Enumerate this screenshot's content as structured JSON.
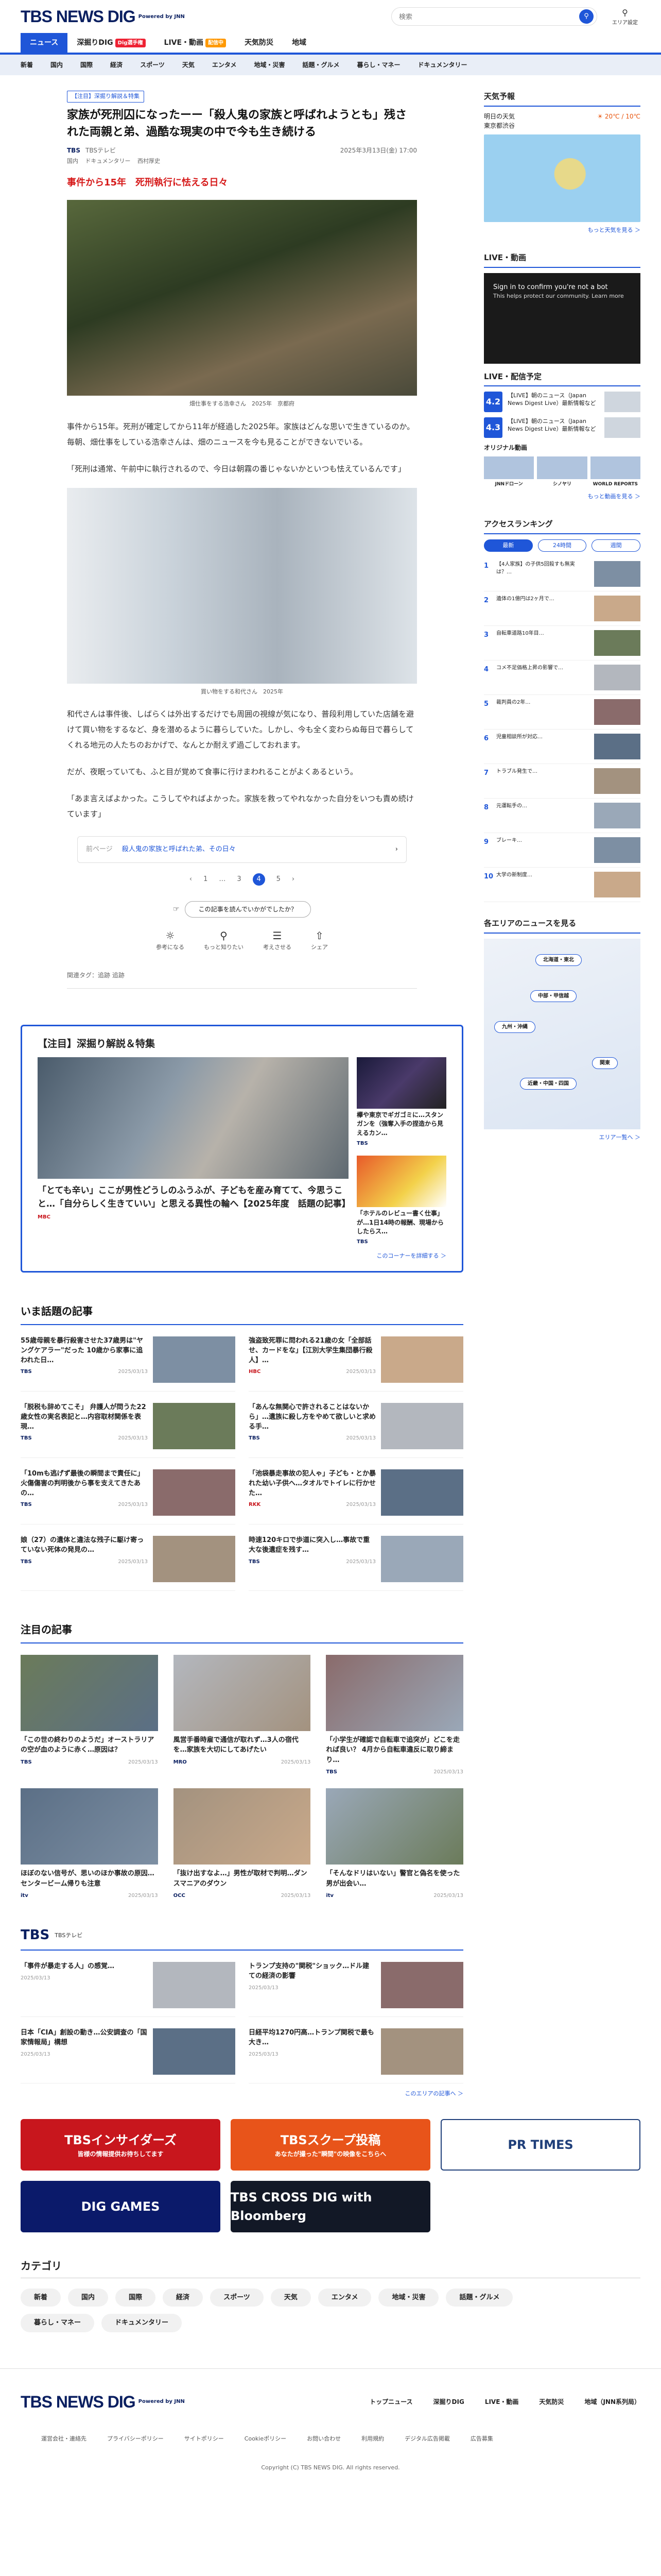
{
  "header": {
    "logo": "TBS NEWS DIG",
    "powered": "Powered by JNN",
    "search_placeholder": "検索",
    "area_label": "エリア設定"
  },
  "nav": [
    {
      "label": "ニュース",
      "badge": ""
    },
    {
      "label": "深掘りDIG",
      "badge": "Dig選手権"
    },
    {
      "label": "LIVE・動画",
      "badge": "配信中"
    },
    {
      "label": "天気防災",
      "badge": ""
    },
    {
      "label": "地域",
      "badge": ""
    }
  ],
  "subnav": [
    "新着",
    "国内",
    "国際",
    "経済",
    "スポーツ",
    "天気",
    "エンタメ",
    "地域・災害",
    "話題・グルメ",
    "暮らし・マネー",
    "ドキュメンタリー"
  ],
  "article": {
    "tag": "【注目】深掘り解説＆特集",
    "title": "家族が死刑囚になったーー「殺人鬼の家族と呼ばれようとも」残された両親と弟、過酷な現実の中で今も生き続ける",
    "source": "TBS",
    "source2": "TBSテレビ",
    "date": "2025年3月13日(金) 17:00",
    "crumbs": [
      "国内",
      "ドキュメンタリー",
      "西村厚史"
    ],
    "subhead": "事件から15年　死刑執行に怯える日々",
    "caption1": "畑仕事をする浩幸さん　2025年　京都府",
    "p1": "事件から15年。死刑が確定してから11年が経過した2025年。家族はどんな思いで生きているのか。毎朝、畑仕事をしている浩幸さんは、畑のニュースを今も見ることができないでいる。",
    "p2": "「死刑は通常、午前中に執行されるので、今日は朝霧の番じゃないかといつも怯えているんです」",
    "caption2": "買い物をする和代さん　2025年",
    "p3": "和代さんは事件後、しばらくは外出するだけでも周囲の視線が気になり、普段利用していた店舗を避けて買い物をするなど、身を潜めるように暮らしていた。しかし、今も全く変わらぬ毎日で暮らしてくれる地元の人たちのおかげで、なんとか耐えず過ごしておれます。",
    "p4": "だが、夜眠っていても、ふと目が覚めて食事に行けまわれることがよくあるという。",
    "p5": "「あま言えばよかった。こうしてやればよかった。家族を救ってやれなかった自分をいつも責め続けています」",
    "prev_label": "前ページ",
    "prev_title": "殺人鬼の家族と呼ばれた弟、その日々",
    "pages": [
      "1",
      "…",
      "3",
      "4",
      "5"
    ],
    "current_page": "4",
    "helpful_q": "この記事を読んでいかがでしたか？",
    "reactions": [
      "参考になる",
      "もっと知りたい",
      "考えさせる",
      "シェア"
    ],
    "credit": "関連タグ：追跡 追跡"
  },
  "feature": {
    "title": "【注目】深掘り解説＆特集",
    "big_title": "「とても辛い」ここが男性どうしのふうふが、子どもを産み育てて、今思うこと…「自分らしく生きていい」と思える異性の輪へ【2025年度　話題の記事】",
    "big_src": "MBC",
    "small": [
      {
        "title": "欅や東京でギガゴミに…スタンガンを（強奪入手の捏造から見えるカン…",
        "src": "TBS"
      },
      {
        "title": "「ホテルのレビュー書く仕事」が…1日14時の報酬、現場からしたらス…",
        "src": "TBS"
      }
    ],
    "more": "このコーナーを詳細する ＞"
  },
  "trending": {
    "title": "いま話題の記事",
    "items": [
      {
        "t": "55歳母親を暴行殺害させた37歳男は\"ヤングケアラー\"だった 10歳から家事に追われた日…",
        "s": "TBS",
        "d": "2025/03/13"
      },
      {
        "t": "強盗致死罪に問われる21歳の女「全部話せ、カードをな」【江別大学生集団暴行殺人】…",
        "s": "HBC",
        "d": "2025/03/13"
      },
      {
        "t": "「脱税も辞めてこそ」 弁護人が問うた22歳女性の実名表記と…内容取材関係を表現…",
        "s": "TBS",
        "d": "2025/03/13"
      },
      {
        "t": "「あんな無関心で許されることはないから」…遺族に殺し方をやめて欲しいと求める手…",
        "s": "TBS",
        "d": "2025/03/13"
      },
      {
        "t": "「10mも逃げず最後の瞬間まで責任に」 火傷傷害の判明後から事を支えてきたあの…",
        "s": "TBS",
        "d": "2025/03/13"
      },
      {
        "t": "「池袋暴走事故の犯人ゃ」子ども・とか暴れた幼い子供へ…タオルでトイレに行かせた…",
        "s": "RKK",
        "d": "2025/03/13"
      },
      {
        "t": "娘（27）の遺体と違法な残子に駆け寄っていない死体の発見の…",
        "s": "TBS",
        "d": "2025/03/13"
      },
      {
        "t": "時速120キロで歩道に突入し…事故で重大な後遺症を残す…",
        "s": "TBS",
        "d": "2025/03/13"
      }
    ]
  },
  "notable": {
    "title": "注目の記事",
    "items": [
      {
        "t": "「この世の終わりのようだ」オーストラリアの空が血のように赤く…原因は？",
        "s": "TBS",
        "d": "2025/03/13"
      },
      {
        "t": "風営手番時雇で通信が取れず…3人の宿代を…家族を大切にしてあげたい",
        "s": "MRO",
        "d": "2025/03/13"
      },
      {
        "t": "「小学生が確認で自転車で追突が」どこを走れば良い？ 4月から自転車違反に取り締まり…",
        "s": "TBS",
        "d": "2025/03/13"
      },
      {
        "t": "ほぼのない信号が、思いのほか事故の原因…センタービーム帰りも注意",
        "s": "itv",
        "d": "2025/03/13"
      },
      {
        "t": "「抜け出すなよ…」男性が取材で判明…ダンスマニアのダウン",
        "s": "OCC",
        "d": "2025/03/13"
      },
      {
        "t": "「そんなドリはいない」警官と偽名を使った男が出会い…",
        "s": "itv",
        "d": "2025/03/13"
      }
    ]
  },
  "tbs": {
    "logo": "TBS",
    "label": "TBSテレビ",
    "items": [
      {
        "t": "「事件が暴走する人」の感覚…",
        "d": "2025/03/13"
      },
      {
        "t": "トランプ支持の\"関税\"ショック…ドル建ての経済の影響",
        "d": "2025/03/13"
      },
      {
        "t": "日本「CIA」創設の動き…公安調査の「国家情報局」構想",
        "d": "2025/03/13"
      },
      {
        "t": "日経平均1270円高…トランプ関税で最も大き…",
        "d": "2025/03/13"
      }
    ],
    "more": "このエリアの記事へ ＞"
  },
  "banners": [
    {
      "label": "TBSインサイダーズ",
      "sub": "皆様の情報提供お待ちしてます",
      "bg": "#c8161d",
      "fg": "#ffffff"
    },
    {
      "label": "TBSスクープ投稿",
      "sub": "あなたが撮った\"瞬間\"の映像をこちらへ",
      "bg": "#e8541a",
      "fg": "#ffffff"
    },
    {
      "label": "PR TIMES",
      "sub": "",
      "bg": "#ffffff",
      "fg": "#1f3f7a"
    },
    {
      "label": "DIG GAMES",
      "sub": "",
      "bg": "#0b1a6a",
      "fg": "#ffffff"
    },
    {
      "label": "TBS CROSS DIG with Bloomberg",
      "sub": "",
      "bg": "#121826",
      "fg": "#ffffff"
    }
  ],
  "categories": {
    "title": "カテゴリ",
    "items": [
      "新着",
      "国内",
      "国際",
      "経済",
      "スポーツ",
      "天気",
      "エンタメ",
      "地域・災害",
      "話題・グルメ",
      "暮らし・マネー",
      "ドキュメンタリー"
    ]
  },
  "footer": {
    "links": [
      "トップニュース",
      "深掘りDIG",
      "LIVE・動画",
      "天気防災",
      "地域（JNN系列局）"
    ],
    "sublinks": [
      "運営会社・連絡先",
      "プライバシーポリシー",
      "サイトポリシー",
      "Cookieポリシー",
      "お問い合わせ",
      "利用規約",
      "デジタル広告掲載",
      "広告募集"
    ],
    "copyright": "Copyright (C) TBS NEWS DIG. All rights reserved."
  },
  "sidebar": {
    "weather_title": "天気予報",
    "weather_day": "明日の天気",
    "weather_city": "東京都渋谷",
    "weather_temp": "20℃ / 10℃",
    "weather_more": "もっと天気を見る ＞",
    "live_title": "LIVE・動画",
    "live_msg": "Sign in to confirm you're not a bot",
    "live_sub": "This helps protect our community. Learn more",
    "schedule_title": "LIVE・配信予定",
    "schedule": [
      {
        "cal": "4.2",
        "t": "【LIVE】朝のニュース（Japan News Digest Live）最新情報など"
      },
      {
        "cal": "4.3",
        "t": "【LIVE】朝のニュース（Japan News Digest Live）最新情報など"
      }
    ],
    "orig_title": "オリジナル動画",
    "orig": [
      "JNNドローン",
      "シノヤリ",
      "WORLD REPORTS"
    ],
    "orig_more": "もっと動画を見る ＞",
    "rank_title": "アクセスランキング",
    "rank_tabs": [
      "最新",
      "24時間",
      "週間"
    ],
    "rank": [
      "【4人家族】の子供5回殺すも無実は？…",
      "遺体の1億円は2ヶ月で…",
      "自転車道路10年目…",
      "コメ不足価格上昇の影響で…",
      "裁判員の2年…",
      "児童相談所が対応…",
      "トラブル発生で…",
      "元運転手の…",
      "ブレーキ…",
      "大学の新制度…"
    ],
    "area_title": "各エリアのニュースを見る",
    "areas": [
      "北海道・東北",
      "中部・甲信越",
      "九州・沖縄",
      "関東",
      "近畿・中国・四国"
    ],
    "area_more": "エリア一覧へ ＞"
  }
}
